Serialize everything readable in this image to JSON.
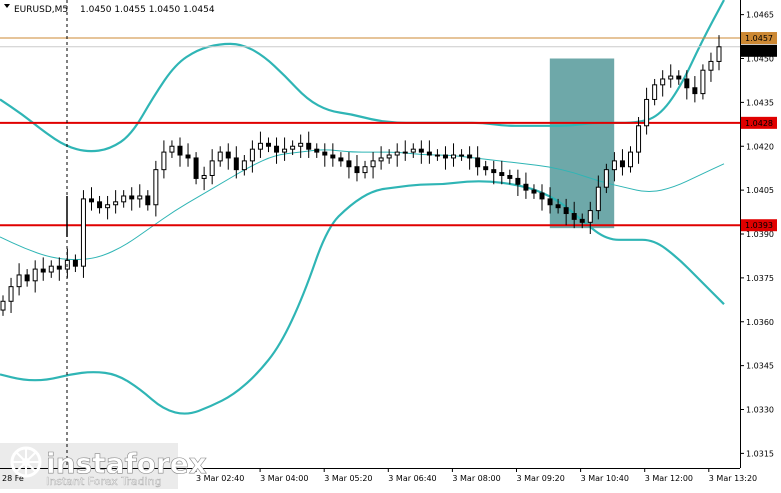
{
  "header": {
    "symbol": "EURUSD,M5",
    "quote": "1.0450 1.0455 1.0450 1.0454",
    "first_date_label": "28 Fe"
  },
  "watermark": {
    "brand": "instaforex",
    "tagline": "Instant Forex Trading"
  },
  "colors": {
    "bollinger": "#2fb5b5",
    "level": "#e00000",
    "current_line": "#cc8833",
    "zone": "#5e9ea0",
    "candle": "#000000"
  },
  "chart_data": {
    "type": "candlestick",
    "symbol": "EURUSD",
    "timeframe": "M5",
    "ylim": [
      1.031,
      1.047
    ],
    "y_ticks": [
      "1.0465",
      "1.0450",
      "1.0435",
      "1.0420",
      "1.0405",
      "1.0390",
      "1.0375",
      "1.0360",
      "1.0345",
      "1.0330",
      "1.0315"
    ],
    "x_ticks": [
      "3 Mar 02:40",
      "3 Mar 04:00",
      "3 Mar 05:20",
      "3 Mar 06:40",
      "3 Mar 08:00",
      "3 Mar 09:20",
      "3 Mar 10:40",
      "3 Mar 12:00",
      "3 Mar 13:20"
    ],
    "levels": [
      {
        "label": "1.0428",
        "value": 1.0428
      },
      {
        "label": "1.0393",
        "value": 1.0393
      }
    ],
    "price_labels": [
      {
        "label": "1.0457",
        "value": 1.0457
      },
      {
        "label": "1.0454",
        "value": 1.0454
      }
    ],
    "zone": {
      "x_start": 0.743,
      "x_end": 0.83,
      "y_low": 1.0392,
      "y_high": 1.045
    },
    "close": [
      1.0367,
      1.0372,
      1.0376,
      1.0374,
      1.0378,
      1.0377,
      1.0379,
      1.0378,
      1.0381,
      1.0379,
      1.0402,
      1.0401,
      1.0399,
      1.04,
      1.0401,
      1.0403,
      1.0402,
      1.0403,
      1.04,
      1.0412,
      1.0418,
      1.042,
      1.0417,
      1.0416,
      1.0409,
      1.041,
      1.0415,
      1.0418,
      1.0416,
      1.0412,
      1.0415,
      1.0419,
      1.0421,
      1.042,
      1.0418,
      1.0419,
      1.042,
      1.0421,
      1.0419,
      1.0418,
      1.0417,
      1.0416,
      1.0415,
      1.0413,
      1.0411,
      1.0413,
      1.0415,
      1.0416,
      1.0417,
      1.0418,
      1.0418,
      1.0419,
      1.0418,
      1.0417,
      1.0417,
      1.0416,
      1.0417,
      1.0417,
      1.0416,
      1.0413,
      1.0412,
      1.0411,
      1.041,
      1.0409,
      1.0407,
      1.0405,
      1.0404,
      1.0402,
      1.04,
      1.0399,
      1.0397,
      1.0395,
      1.0394,
      1.0398,
      1.0406,
      1.0412,
      1.0415,
      1.0413,
      1.0418,
      1.0427,
      1.0436,
      1.0441,
      1.0443,
      1.0444,
      1.0443,
      1.044,
      1.0438,
      1.0446,
      1.0449,
      1.0454
    ],
    "upper_band": [
      1.0436,
      1.0431,
      1.0425,
      1.042,
      1.0418,
      1.0419,
      1.0424,
      1.0437,
      1.0448,
      1.0453,
      1.0455,
      1.0455,
      1.0451,
      1.0444,
      1.0436,
      1.0432,
      1.0431,
      1.0429,
      1.0428,
      1.0428,
      1.0428,
      1.0428,
      1.0428,
      1.0427,
      1.0427,
      1.0427,
      1.0427,
      1.0428,
      1.0428,
      1.0428,
      1.043,
      1.044,
      1.0456,
      1.047
    ],
    "middle_band": [
      1.0389,
      1.0385,
      1.0382,
      1.0381,
      1.0382,
      1.0386,
      1.0392,
      1.0398,
      1.0403,
      1.0408,
      1.0413,
      1.0417,
      1.0418,
      1.0419,
      1.0418,
      1.0418,
      1.0418,
      1.0417,
      1.0417,
      1.0416,
      1.0415,
      1.0414,
      1.0413,
      1.0411,
      1.0408,
      1.0406,
      1.0404,
      1.0406,
      1.041,
      1.0414
    ],
    "lower_band": [
      1.0342,
      1.034,
      1.034,
      1.0342,
      1.0343,
      1.0342,
      1.0337,
      1.033,
      1.0328,
      1.0331,
      1.0335,
      1.0342,
      1.0352,
      1.0369,
      1.0392,
      1.04,
      1.0405,
      1.0406,
      1.0407,
      1.0407,
      1.0408,
      1.0408,
      1.0407,
      1.0405,
      1.0401,
      1.0394,
      1.0388,
      1.0388,
      1.0388,
      1.0382,
      1.0374,
      1.0366
    ]
  }
}
